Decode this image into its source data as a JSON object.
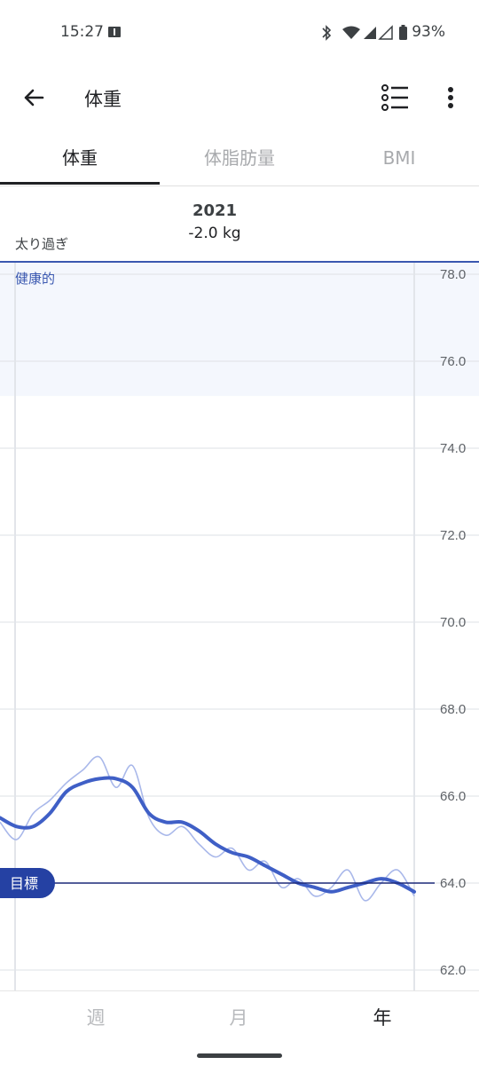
{
  "status_bar": {
    "time": "15:27",
    "battery": "93%",
    "icons": [
      "book-notification-icon",
      "bluetooth-icon",
      "wifi-icon",
      "signal-icon",
      "signal-icon",
      "battery-icon"
    ]
  },
  "app_bar": {
    "title": "体重",
    "back_icon": "arrow-back-icon",
    "list_icon": "list-icon",
    "more_icon": "more-vert-icon"
  },
  "tabs": [
    {
      "label": "体重",
      "active": true
    },
    {
      "label": "体脂肪量",
      "active": false
    },
    {
      "label": "BMI",
      "active": false
    }
  ],
  "summary": {
    "year": "2021",
    "change": "-2.0 kg"
  },
  "zones": {
    "overweight_label": "太り過ぎ",
    "healthy_label": "健康的"
  },
  "goal": {
    "label": "目標",
    "value": 64.0
  },
  "colors": {
    "accent": "#3a58b0",
    "trend_line": "#3f5fc6",
    "raw_line": "#a9b8ea",
    "healthy_band": "#f4f7fd",
    "goal_line": "#1d2a7a",
    "goal_badge": "#2541a3"
  },
  "chart_data": {
    "type": "line",
    "ylim": [
      62.0,
      78.0
    ],
    "yticks": [
      "78.0",
      "76.0",
      "74.0",
      "72.0",
      "70.0",
      "68.0",
      "66.0",
      "64.0",
      "62.0"
    ],
    "healthy_range": [
      75.2,
      78.0
    ],
    "x": [
      0,
      0.04,
      0.08,
      0.12,
      0.16,
      0.2,
      0.24,
      0.28,
      0.32,
      0.36,
      0.4,
      0.44,
      0.48,
      0.52,
      0.56,
      0.6,
      0.64,
      0.68,
      0.72,
      0.76,
      0.8,
      0.84,
      0.88,
      0.92,
      0.96,
      1.0
    ],
    "series": [
      {
        "values": [
          65.5,
          65.3,
          65.3,
          65.6,
          66.1,
          66.3,
          66.4,
          66.4,
          66.2,
          65.6,
          65.4,
          65.4,
          65.2,
          64.9,
          64.7,
          64.6,
          64.4,
          64.2,
          64.0,
          63.9,
          63.8,
          63.9,
          64.0,
          64.1,
          64.0,
          63.8
        ]
      },
      {
        "values": [
          65.4,
          65.0,
          65.6,
          65.9,
          66.3,
          66.6,
          66.9,
          66.2,
          66.7,
          65.5,
          65.1,
          65.3,
          64.9,
          64.6,
          64.8,
          64.3,
          64.5,
          63.9,
          64.1,
          63.7,
          63.9,
          64.3,
          63.6,
          64.0,
          64.3,
          63.7
        ]
      }
    ]
  },
  "periods": [
    {
      "label": "週",
      "active": false
    },
    {
      "label": "月",
      "active": false
    },
    {
      "label": "年",
      "active": true
    }
  ]
}
